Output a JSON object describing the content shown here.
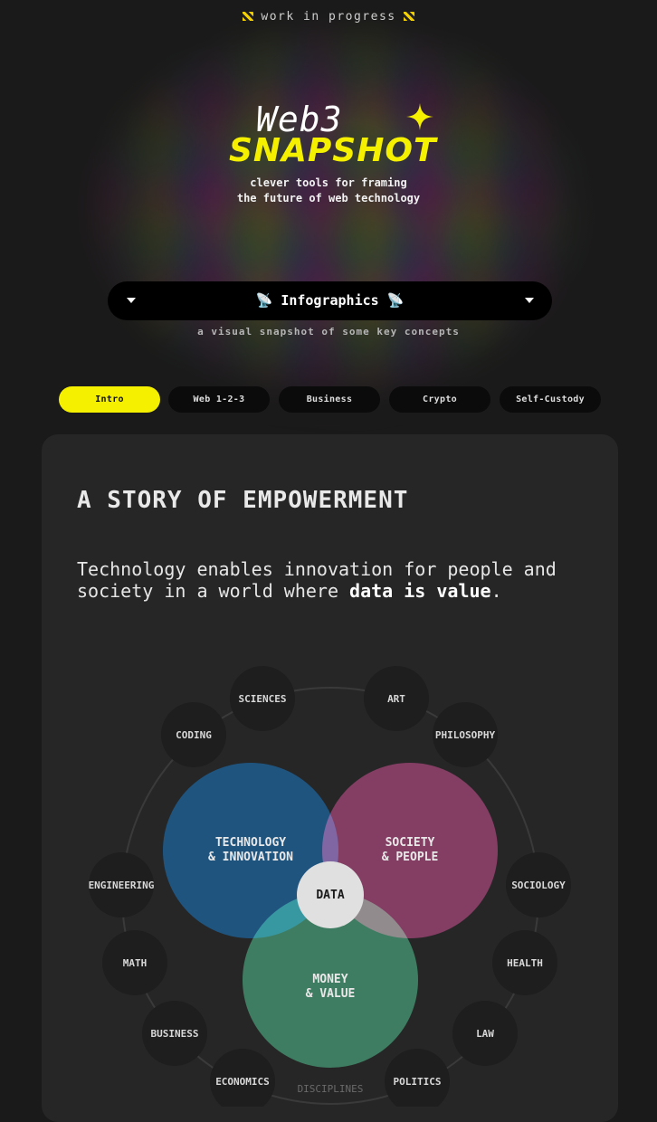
{
  "banner": {
    "text": "work in progress"
  },
  "brand": {
    "line1": "Web3",
    "line2": "SNAPSHOT",
    "accent": "#f5f000"
  },
  "tagline": {
    "line1": "clever tools for framing",
    "line2": "the future of web technology"
  },
  "selector": {
    "label": "Infographics",
    "icon": "satellite-dish-icon"
  },
  "subtitle": "a visual snapshot of some key concepts",
  "tabs": [
    {
      "label": "Intro",
      "active": true
    },
    {
      "label": "Web 1-2-3",
      "active": false
    },
    {
      "label": "Business",
      "active": false
    },
    {
      "label": "Crypto",
      "active": false
    },
    {
      "label": "Self-Custody",
      "active": false
    }
  ],
  "section": {
    "title": "A STORY OF EMPOWERMENT",
    "body_pre": "Technology enables innovation for people and society in a world where ",
    "body_bold": "data is value",
    "body_post": "."
  },
  "diagram": {
    "circles": {
      "tech": {
        "line1": "TECHNOLOGY",
        "line2": "& INNOVATION",
        "color": "#1f5a8a"
      },
      "society": {
        "line1": "SOCIETY",
        "line2": "& PEOPLE",
        "color": "#7a1d50"
      },
      "money": {
        "line1": "MONEY",
        "line2": "& VALUE",
        "color": "#1e6b4a"
      },
      "center": {
        "label": "DATA"
      }
    },
    "disciplines_label": "DISCIPLINES",
    "disciplines": {
      "sciences": "SCIENCES",
      "art": "ART",
      "coding": "CODING",
      "philosophy": "PHILOSOPHY",
      "engineering": "ENGINEERING",
      "sociology": "SOCIOLOGY",
      "math": "MATH",
      "health": "HEALTH",
      "business": "BUSINESS",
      "law": "LAW",
      "economics": "ECONOMICS",
      "politics": "POLITICS"
    }
  }
}
